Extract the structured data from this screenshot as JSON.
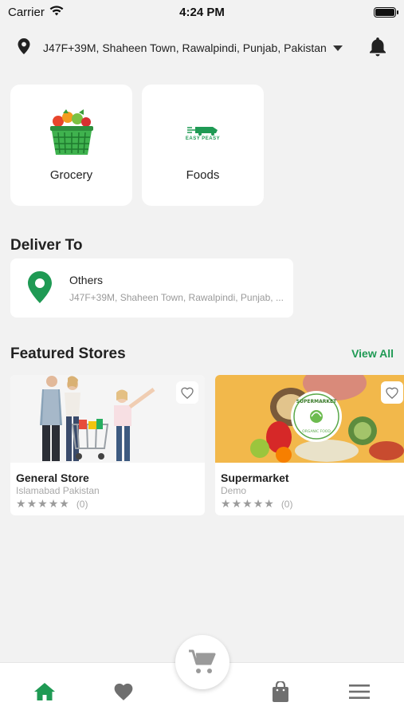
{
  "status_bar": {
    "carrier": "Carrier",
    "time": "4:24 PM"
  },
  "header": {
    "address": "J47F+39M, Shaheen Town, Rawalpindi, Punjab, Pakistan",
    "icons": [
      "location-pin-icon",
      "caret-down-icon",
      "bell-icon"
    ]
  },
  "categories": [
    {
      "label": "Grocery",
      "icon": "grocery-basket-icon"
    },
    {
      "label": "Foods",
      "icon": "easy-peasy-logo",
      "logo_text": "EASY PEASY"
    }
  ],
  "deliver_to": {
    "title": "Deliver To",
    "name": "Others",
    "address": "J47F+39M, Shaheen Town, Rawalpindi, Punjab, ..."
  },
  "featured": {
    "title": "Featured Stores",
    "view_all": "View All",
    "stores": [
      {
        "name": "General Store",
        "location": "Islamabad Pakistan",
        "rating_count": "(0)",
        "stars": 0
      },
      {
        "name": "Supermarket",
        "location": "Demo",
        "rating_count": "(0)",
        "stars": 0,
        "badge_text": "SUPERMARKET",
        "badge_sub": "ORGANIC FOOD"
      }
    ]
  },
  "bottom_nav": {
    "items": [
      "home-icon",
      "heart-icon",
      "cart-icon",
      "bag-icon",
      "menu-icon"
    ],
    "active": "home-icon"
  },
  "colors": {
    "accent": "#1f9a54",
    "background": "#f2f2f2",
    "icon_gray": "#6f6f6f"
  }
}
